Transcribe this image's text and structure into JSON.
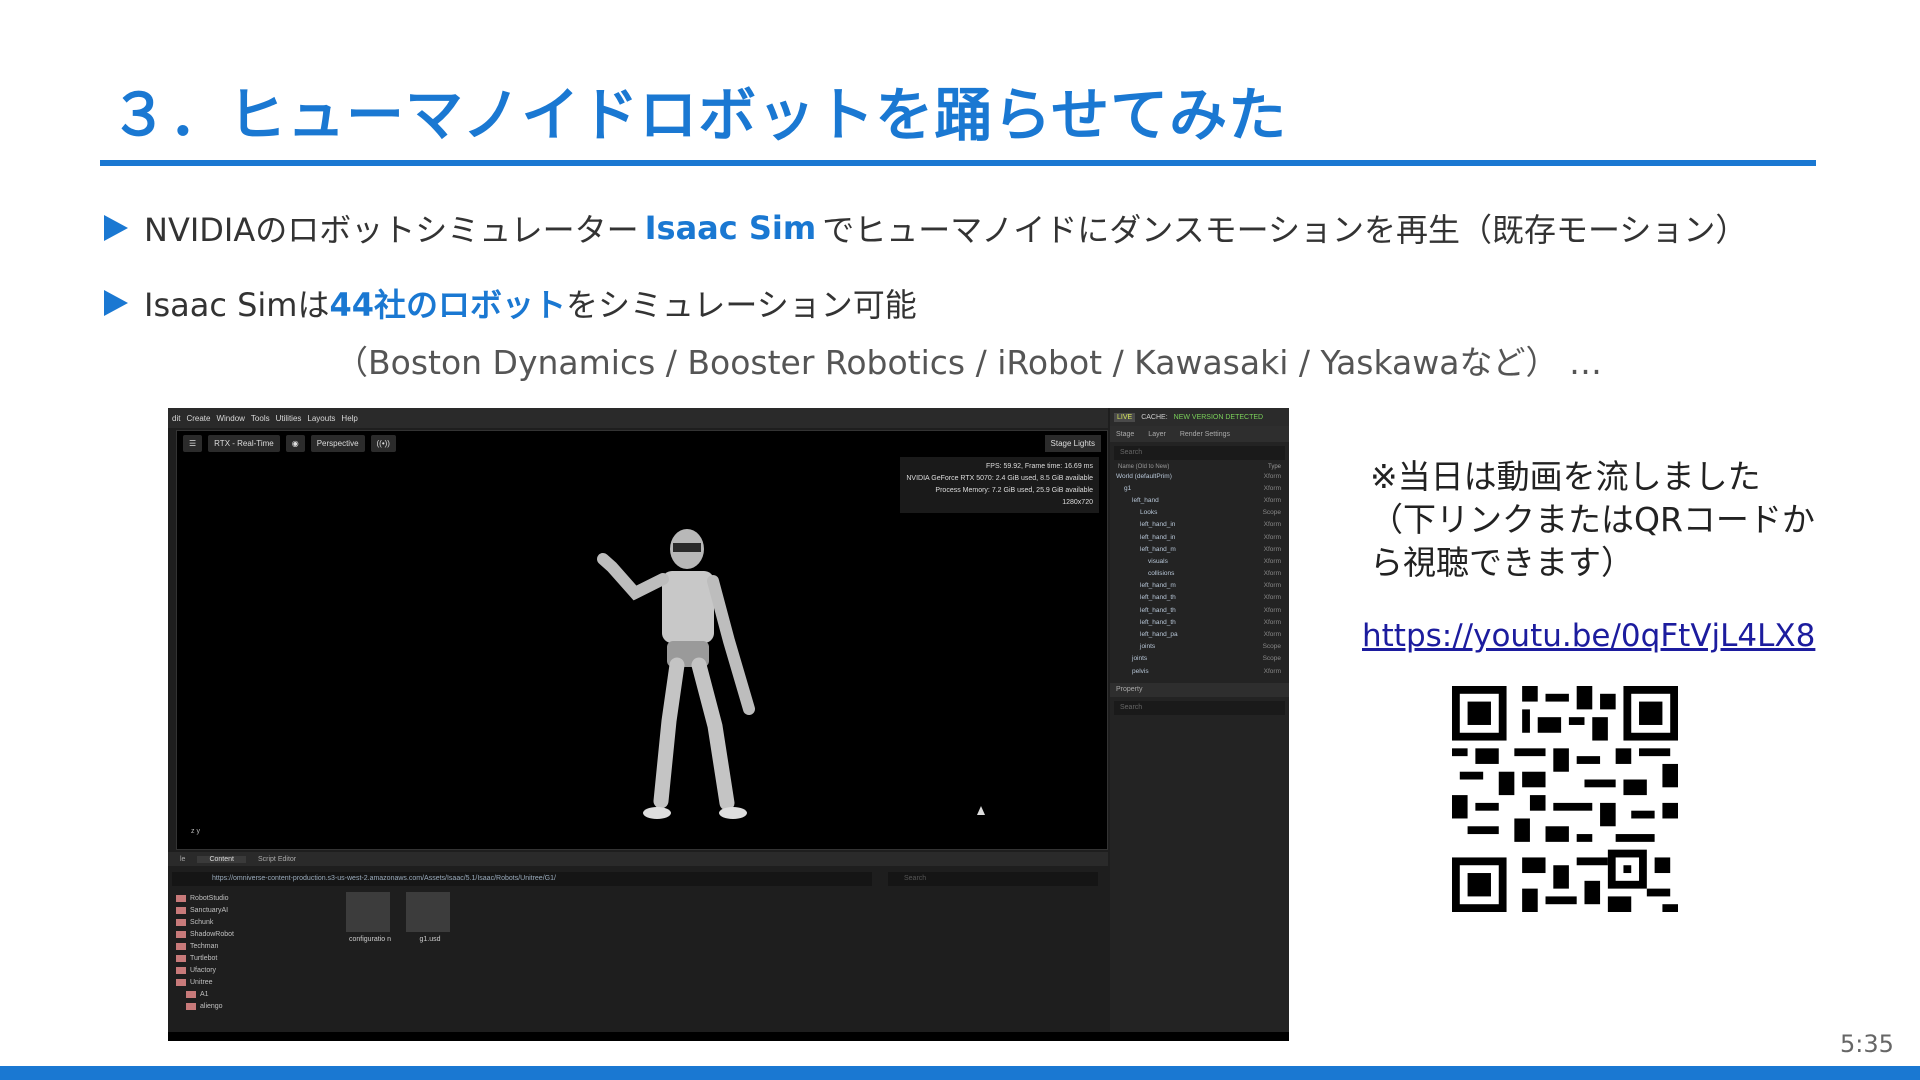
{
  "title": "３．ヒューマノイドロボットを踊らせてみた",
  "bullets": {
    "b1": {
      "pre": "NVIDIAのロボットシミュレーター ",
      "hl": "Isaac Sim",
      "post": " でヒューマノイドにダンスモーションを再生（既存モーション）"
    },
    "b2": {
      "pre": "Isaac Simは ",
      "hl": "44社のロボット",
      "post": "をシミュレーション可能"
    },
    "sub": "（Boston Dynamics / Booster Robotics / iRobot / Kawasaki / Yaskawaなど） …"
  },
  "note": [
    "※当日は動画を流しました",
    "（下リンクまたはQRコードか",
    "ら視聴できます）"
  ],
  "link": "https://youtu.be/0qFtVjL4LX8",
  "page_number": "5:35",
  "colors": {
    "accent": "#1a78d2",
    "link": "#1c1c9e"
  },
  "screenshot": {
    "menu": [
      "dit",
      "Create",
      "Window",
      "Tools",
      "Utilities",
      "Layouts",
      "Help"
    ],
    "toolbar": {
      "render": "RTX - Real-Time",
      "camera": "Perspective",
      "lights": "Stage Lights"
    },
    "stats": [
      "FPS: 59.92, Frame time: 16.69 ms",
      "NVIDIA GeForce RTX 5070: 2.4 GiB used, 8.5 GiB available",
      "Process Memory: 7.2 GiB used, 25.9 GiB available",
      "1280x720"
    ],
    "status": {
      "live": "LIVE",
      "cache": "CACHE:",
      "newver": "NEW VERSION DETECTED"
    },
    "stage_tabs": [
      "Stage",
      "Layer",
      "Render Settings"
    ],
    "search_placeholder": "Search",
    "stage_header": {
      "name": "Name (Old to New)",
      "type": "Type"
    },
    "tree": [
      {
        "name": "World (defaultPrim)",
        "type": "Xform"
      },
      {
        "name": "g1",
        "type": "Xform"
      },
      {
        "name": "left_hand",
        "type": "Xform"
      },
      {
        "name": "Looks",
        "type": "Scope"
      },
      {
        "name": "left_hand_in",
        "type": "Xform"
      },
      {
        "name": "left_hand_in",
        "type": "Xform"
      },
      {
        "name": "left_hand_m",
        "type": "Xform"
      },
      {
        "name": "visuals",
        "type": "Xform"
      },
      {
        "name": "collisions",
        "type": "Xform"
      },
      {
        "name": "left_hand_m",
        "type": "Xform"
      },
      {
        "name": "left_hand_th",
        "type": "Xform"
      },
      {
        "name": "left_hand_th",
        "type": "Xform"
      },
      {
        "name": "left_hand_th",
        "type": "Xform"
      },
      {
        "name": "left_hand_pa",
        "type": "Xform"
      },
      {
        "name": "joints",
        "type": "Scope"
      },
      {
        "name": "joints",
        "type": "Scope"
      },
      {
        "name": "pelvis",
        "type": "Xform"
      }
    ],
    "property_title": "Property",
    "bottom_tabs": [
      "le",
      "Content",
      "Script Editor"
    ],
    "path": "https://omniverse-content-production.s3-us-west-2.amazonaws.com/Assets/Isaac/5.1/Isaac/Robots/Unitree/G1/",
    "folders": [
      "RobotStudio",
      "SanctuaryAI",
      "Schunk",
      "ShadowRobot",
      "Techman",
      "Turtlebot",
      "Ufactory",
      "Unitree",
      "A1",
      "aliengo"
    ],
    "files": [
      "configuratio n",
      "g1.usd"
    ],
    "axis": "z y"
  }
}
